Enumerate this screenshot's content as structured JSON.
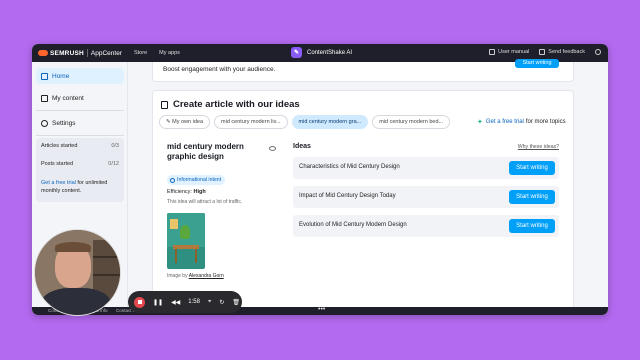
{
  "topbar": {
    "brand": "SEMRUSH",
    "app_center": "AppCenter",
    "nav": [
      "Store",
      "My apps"
    ],
    "app_name": "ContentShake AI",
    "user_manual": "User manual",
    "send_feedback": "Send feedback"
  },
  "sidebar": {
    "items": [
      {
        "label": "Home"
      },
      {
        "label": "My content"
      },
      {
        "label": "Settings"
      }
    ],
    "stats": {
      "articles_label": "Articles started",
      "articles_value": "0/3",
      "posts_label": "Posts started",
      "posts_value": "0/12",
      "trial_link": "Get a free trial",
      "trial_rest": "for unlimited monthly content."
    }
  },
  "main": {
    "top_card_text": "Boost engagement with your audience.",
    "top_card_button": "Start writing",
    "section_title": "Create article with our ideas",
    "chips": [
      {
        "label": "My own idea",
        "selected": false
      },
      {
        "label": "mid century modern liv...",
        "selected": false
      },
      {
        "label": "mid century modern gra...",
        "selected": true
      },
      {
        "label": "mid century modern bed...",
        "selected": false
      }
    ],
    "free_trial_link": "Get a free trial",
    "free_trial_rest": "for more topics",
    "topic": {
      "title": "mid century modern graphic design",
      "intent": "Informational intent",
      "efficiency_label": "Efficiency:",
      "efficiency_value": "High",
      "note": "This idea will attract a lot of traffic.",
      "credit_prefix": "Image by",
      "credit_author": "Alexandra Gorn"
    },
    "ideas_label": "Ideas",
    "why_link": "Why these ideas?",
    "ideas": [
      {
        "title": "Characteristics of Mid Century Design",
        "button": "Start writing"
      },
      {
        "title": "Impact of Mid Century Design Today",
        "button": "Start writing"
      },
      {
        "title": "Evolution of Mid Century Modern Design",
        "button": "Start writing"
      }
    ]
  },
  "footer": {
    "links": [
      "Contact",
      "Legal info",
      "Contact us"
    ]
  },
  "recorder": {
    "timer": "1:58"
  }
}
